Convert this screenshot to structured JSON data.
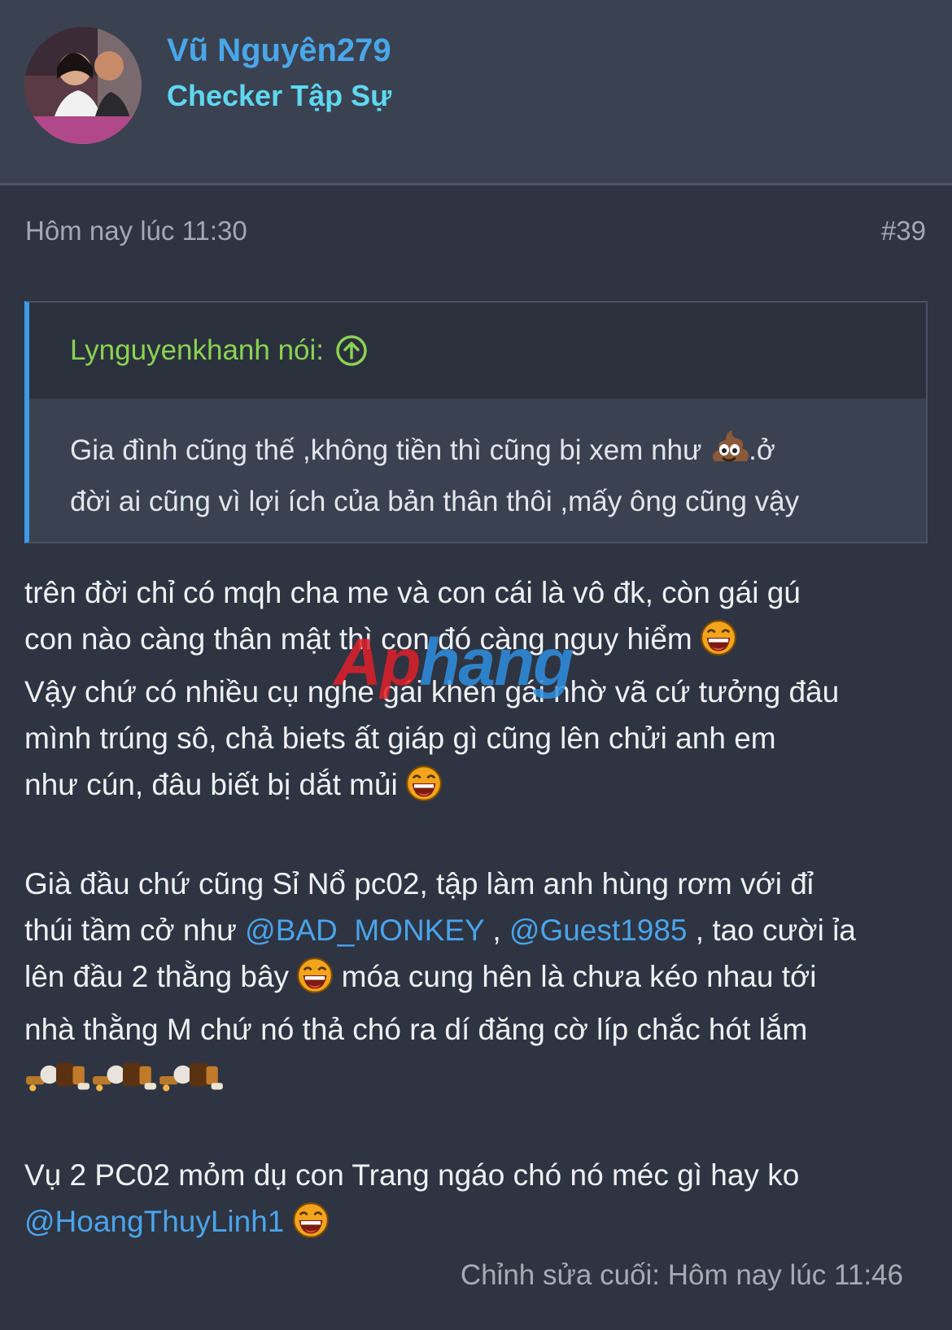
{
  "header": {
    "user_name": "Vũ Nguyên279",
    "user_title": "Checker Tập Sự"
  },
  "post": {
    "time": "Hôm nay lúc 11:30",
    "number": "#39"
  },
  "quote": {
    "author_label": "Lynguyenkhanh nói:",
    "line1_a": "Gia đình cũng thế ,không tiền thì cũng bị xem như ",
    "line1_b": ".ở",
    "line2": "đời ai cũng vì lợi ích của bản thân thôi ,mấy ông cũng vậy"
  },
  "content": {
    "l1": "trên đời chỉ có mqh cha me và con cái là vô đk, còn gái gú",
    "l2": "con nào càng thân mật thì con đó càng nguy hiểm ",
    "l3": "Vậy chứ có nhiều cụ nghe gái khen gái nhờ vã cứ tưởng đâu",
    "l4": "mình trúng sô, chả biets ất giáp gì cũng lên chửi anh em",
    "l5": "như cún, đâu biết bị dắt mủi ",
    "l6": "Già đầu chứ cũng Sỉ Nổ pc02, tập làm anh hùng rơm với đỉ",
    "l7_a": "thúi tầm cở như ",
    "mention1": "@BAD_MONKEY",
    "l7_b": " , ",
    "mention2": "@Guest1985",
    "l7_c": " , tao cười ỉa",
    "l8_a": "lên đầu 2 thằng bây ",
    "l8_b": " móa cung hên là chưa kéo nhau tới",
    "l9": "nhà thằng M chứ nó thả chó ra dí đăng cờ líp chắc hót lắm",
    "l11": "Vụ 2 PC02 mỏm dụ con Trang ngáo chó nó méc gì hay ko",
    "mention3": "@HoangThuyLinh1"
  },
  "edited": "Chỉnh sửa cuối: Hôm nay lúc 11:46",
  "watermark": {
    "part1": "Ap",
    "part2": "hang"
  },
  "icons": [
    "avatar-photo",
    "arrow-up-circle-icon",
    "poop-emoji",
    "laughing-emoji",
    "rocket-emoji"
  ],
  "colors": {
    "background": "#2e3441",
    "header": "#3a4252",
    "user_name": "#49a7e9",
    "user_title": "#5fd8ef",
    "quote_author": "#8bd253",
    "mention": "#4aa4ec",
    "quote_border": "#3f9ae6"
  }
}
